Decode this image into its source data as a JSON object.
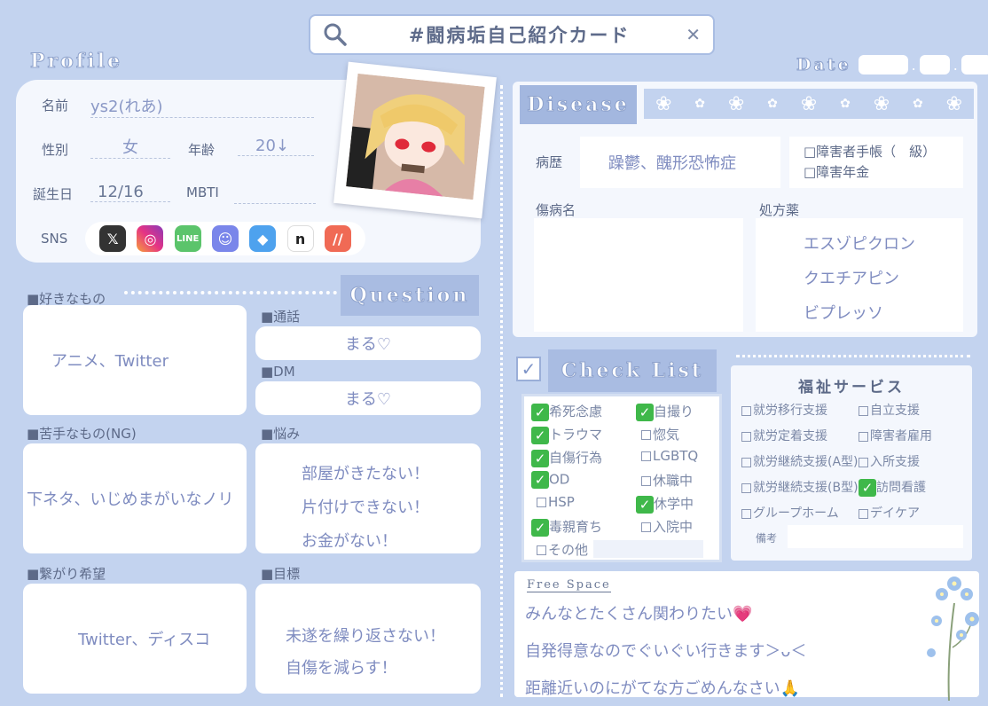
{
  "search": {
    "query": "#闘病垢自己紹介カード",
    "icon": "search-icon",
    "close_icon": "close-icon",
    "close_glyph": "✕"
  },
  "date": {
    "label": "Date",
    "separator": "."
  },
  "profile": {
    "heading": "Profile",
    "name_label": "名前",
    "name_value": "ys2(れあ)",
    "gender_label": "性別",
    "gender_value": "女",
    "age_label": "年齢",
    "age_value": "20↓",
    "birthday_label": "誕生日",
    "birthday_value": "12/16",
    "mbti_label": "MBTI",
    "mbti_value": "",
    "sns_label": "SNS",
    "sns_icons": [
      "x-icon",
      "instagram-icon",
      "line-icon",
      "discord-icon",
      "bluesky-icon",
      "note-icon",
      "misskey-icon"
    ]
  },
  "question": {
    "heading": "Question",
    "likes_label": "■好きなもの",
    "likes_value": "アニメ、Twitter",
    "dislikes_label": "■苦手なもの(NG)",
    "dislikes_value": "下ネタ、いじめまがいなノリ",
    "connect_label": "■繋がり希望",
    "connect_value": "Twitter、ディスコ",
    "call_label": "■通話",
    "call_value": "まる♡",
    "dm_label": "■DM",
    "dm_value": "まる♡",
    "worries_label": "■悩み",
    "worries": [
      "部屋がきたない！",
      "片付けできない！",
      "お金がない！"
    ],
    "goals_label": "■目標",
    "goals": [
      "未遂を繰り返さない！",
      "自傷を減らす！"
    ]
  },
  "disease": {
    "heading": "Disease",
    "history_label": "病歴",
    "history_value": "躁鬱、醜形恐怖症",
    "handbook_label": "□障害者手帳（　級）",
    "pension_label": "□障害年金",
    "injury_label": "傷病名",
    "injury_value": "",
    "prescription_label": "処方薬",
    "prescriptions": [
      "エスゾピクロン",
      "クエチアピン",
      "ビプレッソ"
    ]
  },
  "checklist": {
    "heading": "Check List",
    "items": [
      {
        "label": "希死念慮",
        "checked": true
      },
      {
        "label": "自撮り",
        "checked": true
      },
      {
        "label": "トラウマ",
        "checked": true
      },
      {
        "label": "惚気",
        "checked": false
      },
      {
        "label": "自傷行為",
        "checked": true
      },
      {
        "label": "LGBTQ",
        "checked": false
      },
      {
        "label": "OD",
        "checked": true
      },
      {
        "label": "休職中",
        "checked": false
      },
      {
        "label": "HSP",
        "checked": false
      },
      {
        "label": "休学中",
        "checked": true
      },
      {
        "label": "毒親育ち",
        "checked": true
      },
      {
        "label": "入院中",
        "checked": false
      },
      {
        "label": "その他",
        "checked": false
      }
    ]
  },
  "welfare": {
    "heading": "福祉サービス",
    "items": [
      {
        "label": "就労移行支援",
        "checked": false
      },
      {
        "label": "自立支援",
        "checked": false
      },
      {
        "label": "就労定着支援",
        "checked": false
      },
      {
        "label": "障害者雇用",
        "checked": false
      },
      {
        "label": "就労継続支援(A型)",
        "checked": false
      },
      {
        "label": "入所支援",
        "checked": false
      },
      {
        "label": "就労継続支援(B型)",
        "checked": false
      },
      {
        "label": "訪問看護",
        "checked": true
      },
      {
        "label": "グループホーム",
        "checked": false
      },
      {
        "label": "デイケア",
        "checked": false
      }
    ],
    "notes_label": "備考"
  },
  "free_space": {
    "heading": "Free Space",
    "lines": [
      "みんなとたくさん関わりたい💗",
      "自発得意なのでぐいぐい行きます＞ᴗ＜",
      "距離近いのにがてな方ごめんなさい🙏"
    ]
  },
  "colors": {
    "background": "#c3d3ef",
    "panel": "#e6edf9",
    "accent_text": "#8a98c6",
    "check_green": "#3fb84a"
  }
}
